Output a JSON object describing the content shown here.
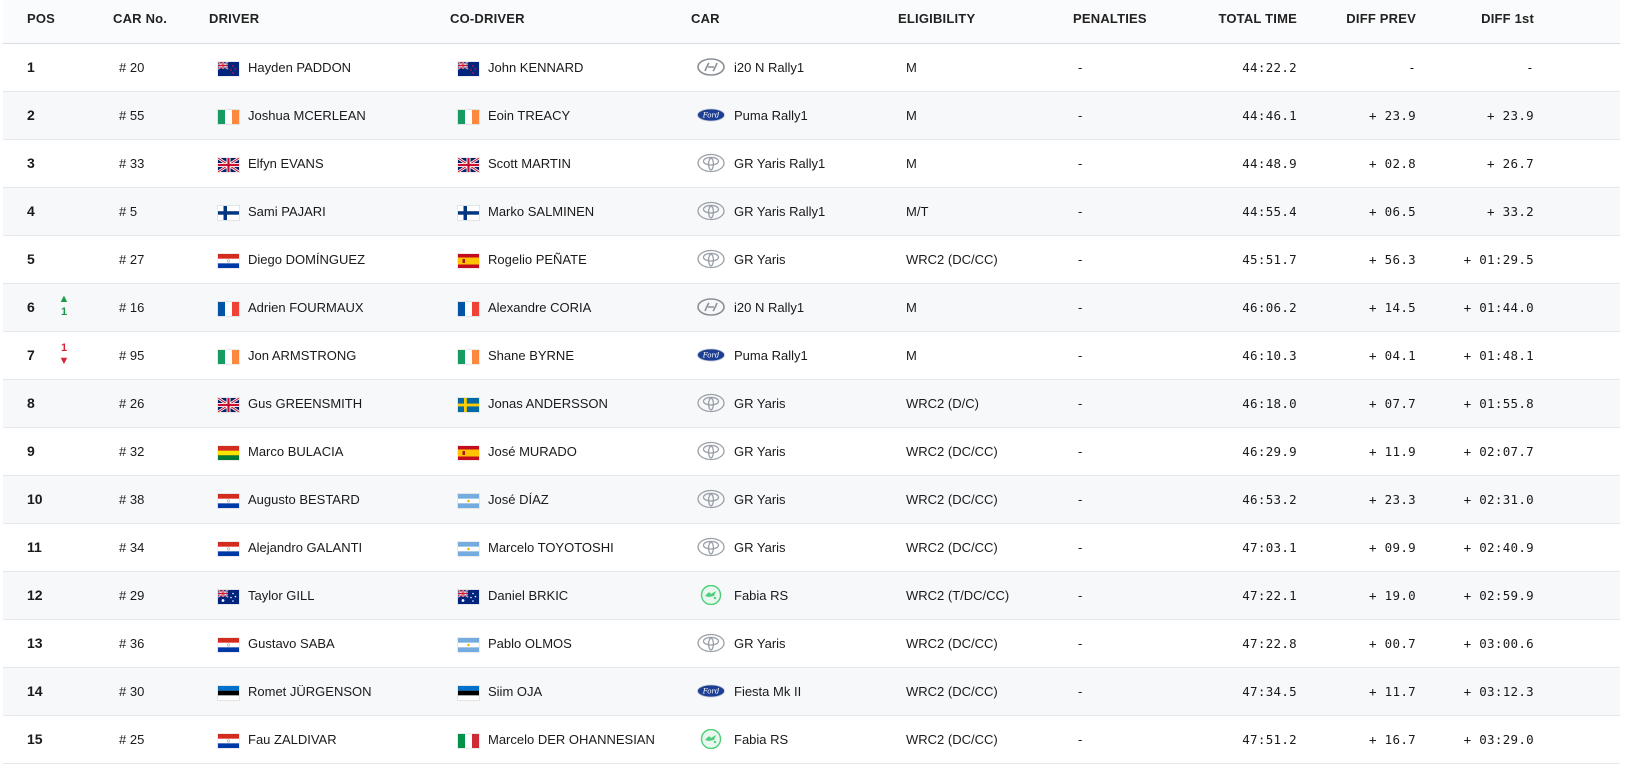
{
  "headers": {
    "pos": "POS",
    "car_no": "CAR No.",
    "driver": "DRIVER",
    "co_driver": "CO-DRIVER",
    "car": "CAR",
    "eligibility": "ELIGIBILITY",
    "penalties": "PENALTIES",
    "total_time": "TOTAL TIME",
    "diff_prev": "DIFF PREV",
    "diff_1st": "DIFF 1st"
  },
  "rows": [
    {
      "pos": "1",
      "car_no": "# 20",
      "driver_flag": "NZ",
      "driver": "Hayden PADDON",
      "co_flag": "NZ",
      "co_driver": "John KENNARD",
      "brand": "hyundai",
      "car": "i20 N Rally1",
      "eligibility": "M",
      "penalties": "-",
      "total_time": "44:22.2",
      "diff_prev": "-",
      "diff_1st": "-",
      "change": "",
      "change_dir": ""
    },
    {
      "pos": "2",
      "car_no": "# 55",
      "driver_flag": "IE",
      "driver": "Joshua MCERLEAN",
      "co_flag": "IE",
      "co_driver": "Eoin TREACY",
      "brand": "ford",
      "car": "Puma Rally1",
      "eligibility": "M",
      "penalties": "-",
      "total_time": "44:46.1",
      "diff_prev": "+ 23.9",
      "diff_1st": "+ 23.9",
      "change": "",
      "change_dir": ""
    },
    {
      "pos": "3",
      "car_no": "# 33",
      "driver_flag": "GB",
      "driver": "Elfyn EVANS",
      "co_flag": "GB",
      "co_driver": "Scott MARTIN",
      "brand": "toyota",
      "car": "GR Yaris Rally1",
      "eligibility": "M",
      "penalties": "-",
      "total_time": "44:48.9",
      "diff_prev": "+ 02.8",
      "diff_1st": "+ 26.7",
      "change": "",
      "change_dir": ""
    },
    {
      "pos": "4",
      "car_no": "# 5",
      "driver_flag": "FI",
      "driver": "Sami PAJARI",
      "co_flag": "FI",
      "co_driver": "Marko SALMINEN",
      "brand": "toyota",
      "car": "GR Yaris Rally1",
      "eligibility": "M/T",
      "penalties": "-",
      "total_time": "44:55.4",
      "diff_prev": "+ 06.5",
      "diff_1st": "+ 33.2",
      "change": "",
      "change_dir": ""
    },
    {
      "pos": "5",
      "car_no": "# 27",
      "driver_flag": "PY",
      "driver": "Diego DOMÍNGUEZ",
      "co_flag": "ES",
      "co_driver": "Rogelio PEÑATE",
      "brand": "toyota",
      "car": "GR Yaris",
      "eligibility": "WRC2 (DC/CC)",
      "penalties": "-",
      "total_time": "45:51.7",
      "diff_prev": "+ 56.3",
      "diff_1st": "+ 01:29.5",
      "change": "",
      "change_dir": ""
    },
    {
      "pos": "6",
      "car_no": "# 16",
      "driver_flag": "FR",
      "driver": "Adrien FOURMAUX",
      "co_flag": "FR",
      "co_driver": "Alexandre CORIA",
      "brand": "hyundai",
      "car": "i20 N Rally1",
      "eligibility": "M",
      "penalties": "-",
      "total_time": "46:06.2",
      "diff_prev": "+ 14.5",
      "diff_1st": "+ 01:44.0",
      "change": "1",
      "change_dir": "up"
    },
    {
      "pos": "7",
      "car_no": "# 95",
      "driver_flag": "IE",
      "driver": "Jon ARMSTRONG",
      "co_flag": "IE",
      "co_driver": "Shane BYRNE",
      "brand": "ford",
      "car": "Puma Rally1",
      "eligibility": "M",
      "penalties": "-",
      "total_time": "46:10.3",
      "diff_prev": "+ 04.1",
      "diff_1st": "+ 01:48.1",
      "change": "1",
      "change_dir": "down"
    },
    {
      "pos": "8",
      "car_no": "# 26",
      "driver_flag": "GB",
      "driver": "Gus GREENSMITH",
      "co_flag": "SE",
      "co_driver": "Jonas ANDERSSON",
      "brand": "toyota",
      "car": "GR Yaris",
      "eligibility": "WRC2 (D/C)",
      "penalties": "-",
      "total_time": "46:18.0",
      "diff_prev": "+ 07.7",
      "diff_1st": "+ 01:55.8",
      "change": "",
      "change_dir": ""
    },
    {
      "pos": "9",
      "car_no": "# 32",
      "driver_flag": "BO",
      "driver": "Marco BULACIA",
      "co_flag": "ES",
      "co_driver": "José MURADO",
      "brand": "toyota",
      "car": "GR Yaris",
      "eligibility": "WRC2 (DC/CC)",
      "penalties": "-",
      "total_time": "46:29.9",
      "diff_prev": "+ 11.9",
      "diff_1st": "+ 02:07.7",
      "change": "",
      "change_dir": ""
    },
    {
      "pos": "10",
      "car_no": "# 38",
      "driver_flag": "PY",
      "driver": "Augusto BESTARD",
      "co_flag": "AR",
      "co_driver": "José DÍAZ",
      "brand": "toyota",
      "car": "GR Yaris",
      "eligibility": "WRC2 (DC/CC)",
      "penalties": "-",
      "total_time": "46:53.2",
      "diff_prev": "+ 23.3",
      "diff_1st": "+ 02:31.0",
      "change": "",
      "change_dir": ""
    },
    {
      "pos": "11",
      "car_no": "# 34",
      "driver_flag": "PY",
      "driver": "Alejandro GALANTI",
      "co_flag": "AR",
      "co_driver": "Marcelo TOYOTOSHI",
      "brand": "toyota",
      "car": "GR Yaris",
      "eligibility": "WRC2 (DC/CC)",
      "penalties": "-",
      "total_time": "47:03.1",
      "diff_prev": "+ 09.9",
      "diff_1st": "+ 02:40.9",
      "change": "",
      "change_dir": ""
    },
    {
      "pos": "12",
      "car_no": "# 29",
      "driver_flag": "AU",
      "driver": "Taylor GILL",
      "co_flag": "AU",
      "co_driver": "Daniel BRKIC",
      "brand": "skoda",
      "car": "Fabia RS",
      "eligibility": "WRC2 (T/DC/CC)",
      "penalties": "-",
      "total_time": "47:22.1",
      "diff_prev": "+ 19.0",
      "diff_1st": "+ 02:59.9",
      "change": "",
      "change_dir": ""
    },
    {
      "pos": "13",
      "car_no": "# 36",
      "driver_flag": "PY",
      "driver": "Gustavo SABA",
      "co_flag": "AR",
      "co_driver": "Pablo OLMOS",
      "brand": "toyota",
      "car": "GR Yaris",
      "eligibility": "WRC2 (DC/CC)",
      "penalties": "-",
      "total_time": "47:22.8",
      "diff_prev": "+ 00.7",
      "diff_1st": "+ 03:00.6",
      "change": "",
      "change_dir": ""
    },
    {
      "pos": "14",
      "car_no": "# 30",
      "driver_flag": "EE",
      "driver": "Romet JÜRGENSON",
      "co_flag": "EE",
      "co_driver": "Siim OJA",
      "brand": "ford",
      "car": "Fiesta Mk II",
      "eligibility": "WRC2 (DC/CC)",
      "penalties": "-",
      "total_time": "47:34.5",
      "diff_prev": "+ 11.7",
      "diff_1st": "+ 03:12.3",
      "change": "",
      "change_dir": ""
    },
    {
      "pos": "15",
      "car_no": "# 25",
      "driver_flag": "PY",
      "driver": "Fau ZALDIVAR",
      "co_flag": "IT",
      "co_driver": "Marcelo DER OHANNESIAN",
      "brand": "skoda",
      "car": "Fabia RS",
      "eligibility": "WRC2 (DC/CC)",
      "penalties": "-",
      "total_time": "47:51.2",
      "diff_prev": "+ 16.7",
      "diff_1st": "+ 03:29.0",
      "change": "",
      "change_dir": ""
    }
  ]
}
